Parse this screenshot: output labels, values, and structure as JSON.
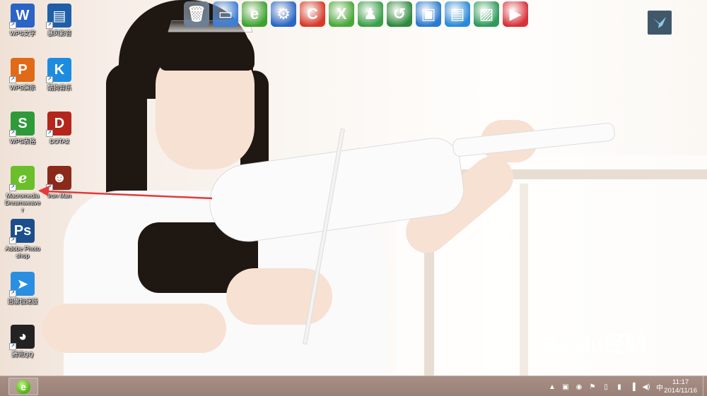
{
  "desktop": {
    "icons": [
      {
        "label": "WPS文字",
        "glyph": "W",
        "color": "#2b63c6",
        "icon": "wps-writer-icon"
      },
      {
        "label": "暴风影音",
        "glyph": "▤",
        "color": "#1f5fa8",
        "icon": "baofeng-player-icon"
      },
      {
        "label": "WPS演示",
        "glyph": "P",
        "color": "#e06a17",
        "icon": "wps-presentation-icon"
      },
      {
        "label": "酷狗音乐",
        "glyph": "K",
        "color": "#1d8ce0",
        "icon": "kugou-music-icon"
      },
      {
        "label": "WPS表格",
        "glyph": "S",
        "color": "#2e9a3a",
        "icon": "wps-spreadsheet-icon"
      },
      {
        "label": "DOTA2",
        "glyph": "D",
        "color": "#b4251c",
        "icon": "dota2-icon"
      },
      {
        "label": "Macromedia Dreamweaver",
        "glyph": "ℯ",
        "color": "#6abf2a",
        "icon": "dreamweaver-icon"
      },
      {
        "label": "Iron Man",
        "glyph": "☻",
        "color": "#8a2a1a",
        "icon": "iron-man-icon"
      },
      {
        "label": "Adobe Photoshop",
        "glyph": "Ps",
        "color": "#1b4f8c",
        "icon": "photoshop-icon"
      },
      {
        "label": "迅雷极速版",
        "glyph": "➤",
        "color": "#2a8fe0",
        "icon": "xunlei-icon"
      },
      {
        "label": "腾讯QQ",
        "glyph": "◕",
        "color": "#222222",
        "icon": "qq-penguin-icon"
      }
    ]
  },
  "dock": {
    "items": [
      {
        "name": "recycle-bin",
        "glyph": "🗑",
        "color": "#6b7f95"
      },
      {
        "name": "computer",
        "glyph": "▭",
        "color": "#3d7fd6"
      },
      {
        "name": "internet-explorer",
        "glyph": "e",
        "color": "#3da32f"
      },
      {
        "name": "settings",
        "glyph": "⚙",
        "color": "#2a66c4"
      },
      {
        "name": "ccleaner",
        "glyph": "C",
        "color": "#d73a2a"
      },
      {
        "name": "excel-tool",
        "glyph": "X",
        "color": "#4aa83a"
      },
      {
        "name": "user-account",
        "glyph": "♟",
        "color": "#3aa04a"
      },
      {
        "name": "backup-restore",
        "glyph": "↺",
        "color": "#2f8a3f"
      },
      {
        "name": "window-switcher",
        "glyph": "▣",
        "color": "#2b7ad0"
      },
      {
        "name": "documents-folder",
        "glyph": "▤",
        "color": "#2b8ad8"
      },
      {
        "name": "pictures-folder",
        "glyph": "▨",
        "color": "#2f9a5a"
      },
      {
        "name": "videos-folder",
        "glyph": "▶",
        "color": "#d8323a"
      }
    ]
  },
  "watermark": {
    "brand": "Baidu经验",
    "url": "jingyan.baidu.com"
  },
  "taskbar": {
    "start_glyph": "e",
    "tray_icons": [
      "▲",
      "▣",
      "◉",
      "⚑",
      "▯",
      "▮",
      "▐",
      "◀)",
      "中"
    ],
    "clock": {
      "time": "11:17",
      "date": "2014/11/16"
    }
  }
}
